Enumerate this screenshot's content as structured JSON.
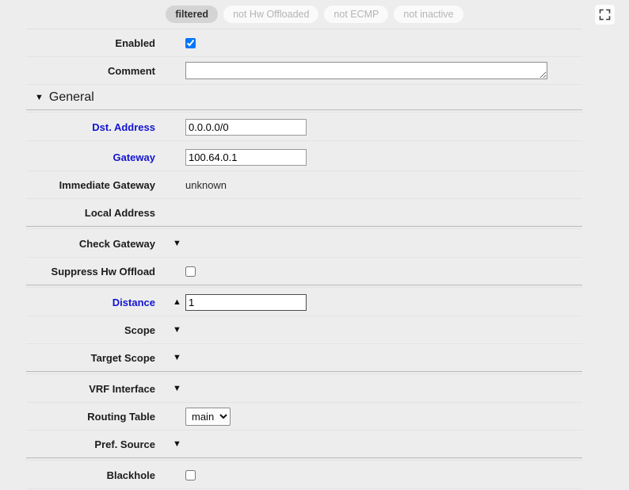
{
  "filters": {
    "chips": [
      {
        "label": "filtered",
        "state": "active"
      },
      {
        "label": "not Hw Offloaded",
        "state": "inactive"
      },
      {
        "label": "not ECMP",
        "state": "inactive"
      },
      {
        "label": "not inactive",
        "state": "inactive"
      }
    ],
    "expand_icon": "fullscreen-icon"
  },
  "form": {
    "enabled": {
      "label": "Enabled",
      "checked": true
    },
    "comment": {
      "label": "Comment",
      "value": "",
      "placeholder": ""
    },
    "section_general": {
      "label": "General",
      "caret": "▼"
    },
    "dst_address": {
      "label": "Dst. Address",
      "value": "0.0.0.0/0"
    },
    "gateway": {
      "label": "Gateway",
      "value": "100.64.0.1"
    },
    "immediate_gateway": {
      "label": "Immediate Gateway",
      "value": "unknown"
    },
    "local_address": {
      "label": "Local Address",
      "value": ""
    },
    "check_gateway": {
      "label": "Check Gateway",
      "caret": "▼"
    },
    "suppress_hw_offload": {
      "label": "Suppress Hw Offload",
      "checked": false
    },
    "distance": {
      "label": "Distance",
      "caret": "▲",
      "value": "1"
    },
    "scope": {
      "label": "Scope",
      "caret": "▼"
    },
    "target_scope": {
      "label": "Target Scope",
      "caret": "▼"
    },
    "vrf_interface": {
      "label": "VRF Interface",
      "caret": "▼"
    },
    "routing_table": {
      "label": "Routing Table",
      "value": "main",
      "options": [
        "main"
      ]
    },
    "pref_source": {
      "label": "Pref. Source",
      "caret": "▼"
    },
    "blackhole": {
      "label": "Blackhole",
      "checked": false
    }
  },
  "colors": {
    "link": "#1414d2",
    "accent_checkbox": "#1a7aeb",
    "background": "#ededed",
    "chip_active_bg": "#d4d4d4"
  }
}
